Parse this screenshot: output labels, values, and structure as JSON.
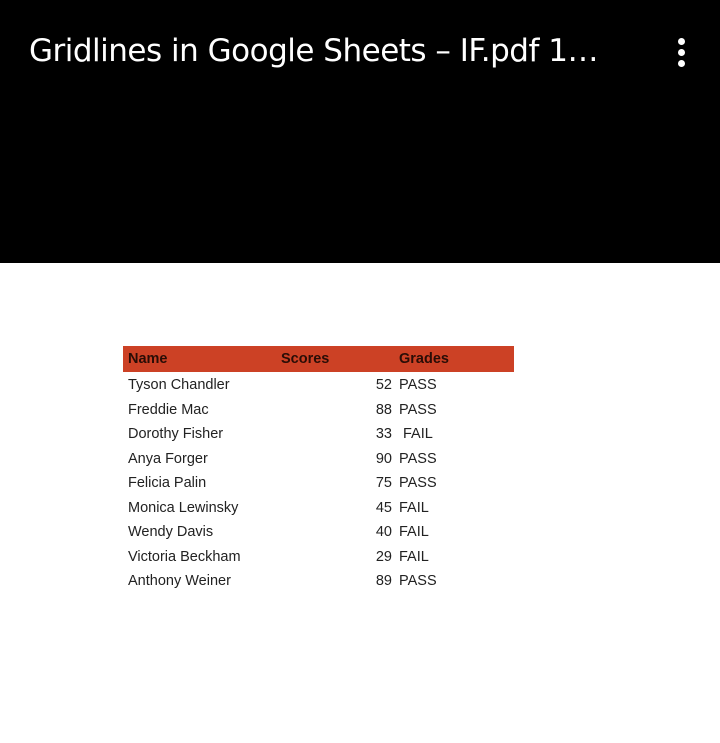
{
  "header": {
    "title": "Gridlines in Google Sheets – IF.pdf  1…",
    "menu_icon": "more-vert-icon"
  },
  "colors": {
    "header_bar": "#000000",
    "table_header": "#cc4125"
  },
  "table": {
    "columns": [
      "Name",
      "Scores",
      "Grades"
    ],
    "rows": [
      {
        "name": "Tyson Chandler",
        "score": "52",
        "grade": "PASS"
      },
      {
        "name": "Freddie Mac",
        "score": "88",
        "grade": "PASS"
      },
      {
        "name": "Dorothy Fisher",
        "score": "33",
        "grade": "FAIL"
      },
      {
        "name": "Anya Forger",
        "score": "90",
        "grade": "PASS"
      },
      {
        "name": "Felicia Palin",
        "score": "75",
        "grade": "PASS"
      },
      {
        "name": "Monica Lewinsky",
        "score": "45",
        "grade": "FAIL"
      },
      {
        "name": "Wendy Davis",
        "score": "40",
        "grade": "FAIL"
      },
      {
        "name": "Victoria Beckham",
        "score": "29",
        "grade": "FAIL"
      },
      {
        "name": "Anthony Weiner",
        "score": "89",
        "grade": "PASS"
      }
    ]
  }
}
